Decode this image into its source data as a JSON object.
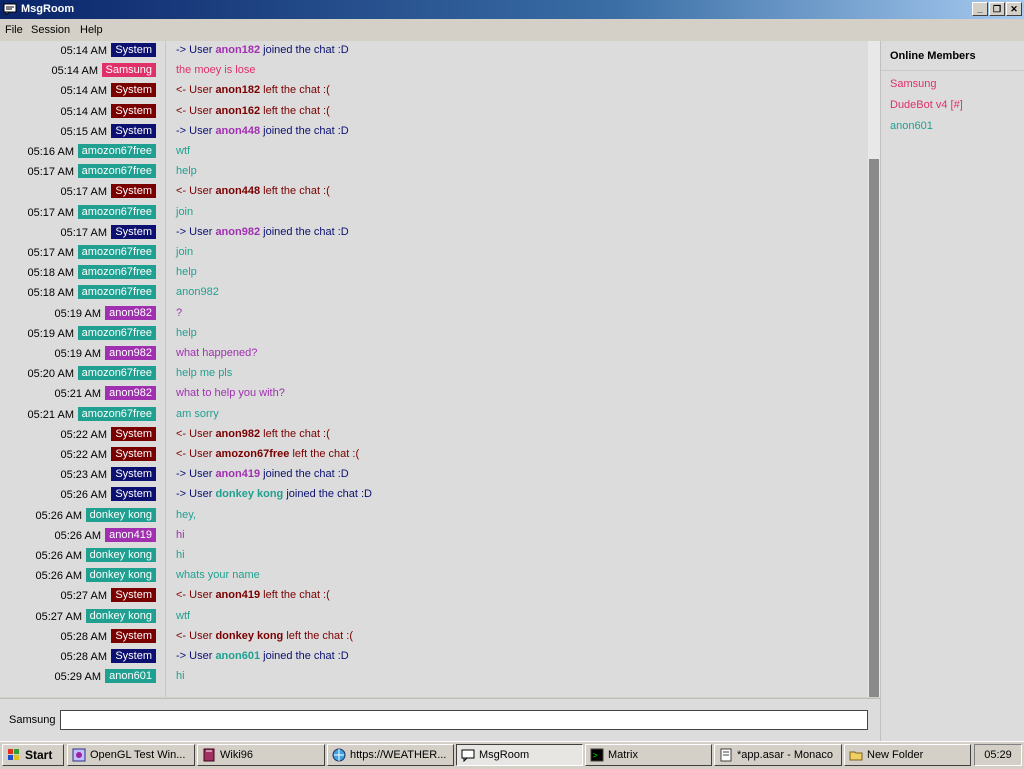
{
  "window": {
    "title": "MsgRoom"
  },
  "menu": [
    "File",
    "Session",
    "Help"
  ],
  "colors": {
    "system": "#0c1070",
    "system_leave": "#800000",
    "samsung": "#e0306a",
    "amozon": "#20a090",
    "anon982": "#a030b0",
    "donkey": "#20a090",
    "anon419": "#a030b0",
    "anon601": "#20a090"
  },
  "messages": [
    {
      "time": "05:14 AM",
      "user": "System",
      "bc": "#0c1070",
      "parts": [
        {
          "t": "-> User ",
          "c": "#0c1070"
        },
        {
          "t": "anon182",
          "c": "#a030b0",
          "b": true
        },
        {
          "t": " joined the chat :D",
          "c": "#0c1070"
        }
      ]
    },
    {
      "time": "05:14 AM",
      "user": "Samsung",
      "bc": "#e0306a",
      "parts": [
        {
          "t": "the moey is lose",
          "c": "#e0306a"
        }
      ]
    },
    {
      "time": "05:14 AM",
      "user": "System",
      "bc": "#7a0000",
      "parts": [
        {
          "t": "<- User ",
          "c": "#7a0000"
        },
        {
          "t": "anon182",
          "c": "#7a0000",
          "b": true
        },
        {
          "t": " left the chat :(",
          "c": "#7a0000"
        }
      ]
    },
    {
      "time": "05:14 AM",
      "user": "System",
      "bc": "#7a0000",
      "parts": [
        {
          "t": "<- User ",
          "c": "#7a0000"
        },
        {
          "t": "anon162",
          "c": "#7a0000",
          "b": true
        },
        {
          "t": " left the chat :(",
          "c": "#7a0000"
        }
      ]
    },
    {
      "time": "05:15 AM",
      "user": "System",
      "bc": "#0c1070",
      "parts": [
        {
          "t": "-> User ",
          "c": "#0c1070"
        },
        {
          "t": "anon448",
          "c": "#a030b0",
          "b": true
        },
        {
          "t": " joined the chat :D",
          "c": "#0c1070"
        }
      ]
    },
    {
      "time": "05:16 AM",
      "user": "amozon67free",
      "bc": "#20a090",
      "parts": [
        {
          "t": "wtf",
          "c": "#20a090"
        }
      ]
    },
    {
      "time": "05:17 AM",
      "user": "amozon67free",
      "bc": "#20a090",
      "parts": [
        {
          "t": "help",
          "c": "#20a090"
        }
      ]
    },
    {
      "time": "05:17 AM",
      "user": "System",
      "bc": "#7a0000",
      "parts": [
        {
          "t": "<- User ",
          "c": "#7a0000"
        },
        {
          "t": "anon448",
          "c": "#7a0000",
          "b": true
        },
        {
          "t": " left the chat :(",
          "c": "#7a0000"
        }
      ]
    },
    {
      "time": "05:17 AM",
      "user": "amozon67free",
      "bc": "#20a090",
      "parts": [
        {
          "t": "join",
          "c": "#20a090"
        }
      ]
    },
    {
      "time": "05:17 AM",
      "user": "System",
      "bc": "#0c1070",
      "parts": [
        {
          "t": "-> User ",
          "c": "#0c1070"
        },
        {
          "t": "anon982",
          "c": "#a030b0",
          "b": true
        },
        {
          "t": " joined the chat :D",
          "c": "#0c1070"
        }
      ]
    },
    {
      "time": "05:17 AM",
      "user": "amozon67free",
      "bc": "#20a090",
      "parts": [
        {
          "t": "join",
          "c": "#20a090"
        }
      ]
    },
    {
      "time": "05:18 AM",
      "user": "amozon67free",
      "bc": "#20a090",
      "parts": [
        {
          "t": "help",
          "c": "#20a090"
        }
      ]
    },
    {
      "time": "05:18 AM",
      "user": "amozon67free",
      "bc": "#20a090",
      "parts": [
        {
          "t": "anon982",
          "c": "#20a090"
        }
      ]
    },
    {
      "time": "05:19 AM",
      "user": "anon982",
      "bc": "#a030b0",
      "parts": [
        {
          "t": "?",
          "c": "#a030b0"
        }
      ]
    },
    {
      "time": "05:19 AM",
      "user": "amozon67free",
      "bc": "#20a090",
      "parts": [
        {
          "t": "help",
          "c": "#20a090"
        }
      ]
    },
    {
      "time": "05:19 AM",
      "user": "anon982",
      "bc": "#a030b0",
      "parts": [
        {
          "t": "what happened?",
          "c": "#a030b0"
        }
      ]
    },
    {
      "time": "05:20 AM",
      "user": "amozon67free",
      "bc": "#20a090",
      "parts": [
        {
          "t": "help me pls",
          "c": "#20a090"
        }
      ]
    },
    {
      "time": "05:21 AM",
      "user": "anon982",
      "bc": "#a030b0",
      "parts": [
        {
          "t": "what to help you with?",
          "c": "#a030b0"
        }
      ]
    },
    {
      "time": "05:21 AM",
      "user": "amozon67free",
      "bc": "#20a090",
      "parts": [
        {
          "t": "am sorry",
          "c": "#20a090"
        }
      ]
    },
    {
      "time": "05:22 AM",
      "user": "System",
      "bc": "#7a0000",
      "parts": [
        {
          "t": "<- User ",
          "c": "#7a0000"
        },
        {
          "t": "anon982",
          "c": "#7a0000",
          "b": true
        },
        {
          "t": " left the chat :(",
          "c": "#7a0000"
        }
      ]
    },
    {
      "time": "05:22 AM",
      "user": "System",
      "bc": "#7a0000",
      "parts": [
        {
          "t": "<- User ",
          "c": "#7a0000"
        },
        {
          "t": "amozon67free",
          "c": "#7a0000",
          "b": true
        },
        {
          "t": " left the chat :(",
          "c": "#7a0000"
        }
      ]
    },
    {
      "time": "05:23 AM",
      "user": "System",
      "bc": "#0c1070",
      "parts": [
        {
          "t": "-> User ",
          "c": "#0c1070"
        },
        {
          "t": "anon419",
          "c": "#a030b0",
          "b": true
        },
        {
          "t": " joined the chat :D",
          "c": "#0c1070"
        }
      ]
    },
    {
      "time": "05:26 AM",
      "user": "System",
      "bc": "#0c1070",
      "parts": [
        {
          "t": "-> User ",
          "c": "#0c1070"
        },
        {
          "t": "donkey kong",
          "c": "#20a090",
          "b": true
        },
        {
          "t": " joined the chat :D",
          "c": "#0c1070"
        }
      ]
    },
    {
      "time": "05:26 AM",
      "user": "donkey kong",
      "bc": "#20a090",
      "parts": [
        {
          "t": "hey,",
          "c": "#20a090"
        }
      ]
    },
    {
      "time": "05:26 AM",
      "user": "anon419",
      "bc": "#a030b0",
      "parts": [
        {
          "t": "hi",
          "c": "#a030b0"
        }
      ]
    },
    {
      "time": "05:26 AM",
      "user": "donkey kong",
      "bc": "#20a090",
      "parts": [
        {
          "t": "hi",
          "c": "#20a090"
        }
      ]
    },
    {
      "time": "05:26 AM",
      "user": "donkey kong",
      "bc": "#20a090",
      "parts": [
        {
          "t": "whats your name",
          "c": "#20a090"
        }
      ]
    },
    {
      "time": "05:27 AM",
      "user": "System",
      "bc": "#7a0000",
      "parts": [
        {
          "t": "<- User ",
          "c": "#7a0000"
        },
        {
          "t": "anon419",
          "c": "#7a0000",
          "b": true
        },
        {
          "t": " left the chat :(",
          "c": "#7a0000"
        }
      ]
    },
    {
      "time": "05:27 AM",
      "user": "donkey kong",
      "bc": "#20a090",
      "parts": [
        {
          "t": "wtf",
          "c": "#20a090"
        }
      ]
    },
    {
      "time": "05:28 AM",
      "user": "System",
      "bc": "#7a0000",
      "parts": [
        {
          "t": "<- User ",
          "c": "#7a0000"
        },
        {
          "t": "donkey kong",
          "c": "#7a0000",
          "b": true
        },
        {
          "t": " left the chat :(",
          "c": "#7a0000"
        }
      ]
    },
    {
      "time": "05:28 AM",
      "user": "System",
      "bc": "#0c1070",
      "parts": [
        {
          "t": "-> User ",
          "c": "#0c1070"
        },
        {
          "t": "anon601",
          "c": "#20a090",
          "b": true
        },
        {
          "t": " joined the chat :D",
          "c": "#0c1070"
        }
      ]
    },
    {
      "time": "05:29 AM",
      "user": "anon601",
      "bc": "#20a090",
      "parts": [
        {
          "t": "hi",
          "c": "#20a090"
        }
      ]
    }
  ],
  "members": {
    "title": "Online Members",
    "list": [
      {
        "name": "Samsung",
        "color": "#e0306a"
      },
      {
        "name": "DudeBot v4 [#]",
        "color": "#e0306a"
      },
      {
        "name": "anon601",
        "color": "#20a090"
      }
    ]
  },
  "input": {
    "label": "Samsung",
    "value": ""
  },
  "taskbar": {
    "start": "Start",
    "tasks": [
      {
        "label": "OpenGL Test Win...",
        "icon": "opengl-icon"
      },
      {
        "label": "Wiki96",
        "icon": "book-icon"
      },
      {
        "label": "https://WEATHER...",
        "icon": "globe-icon"
      },
      {
        "label": "MsgRoom",
        "icon": "chat-icon",
        "active": true
      },
      {
        "label": "Matrix",
        "icon": "terminal-icon"
      },
      {
        "label": "*app.asar - Monaco",
        "icon": "editor-icon"
      },
      {
        "label": "New Folder",
        "icon": "folder-icon"
      }
    ],
    "clock": "05:29"
  },
  "scrollbar": {
    "position": 0.18,
    "visible_fraction": 0.82
  }
}
